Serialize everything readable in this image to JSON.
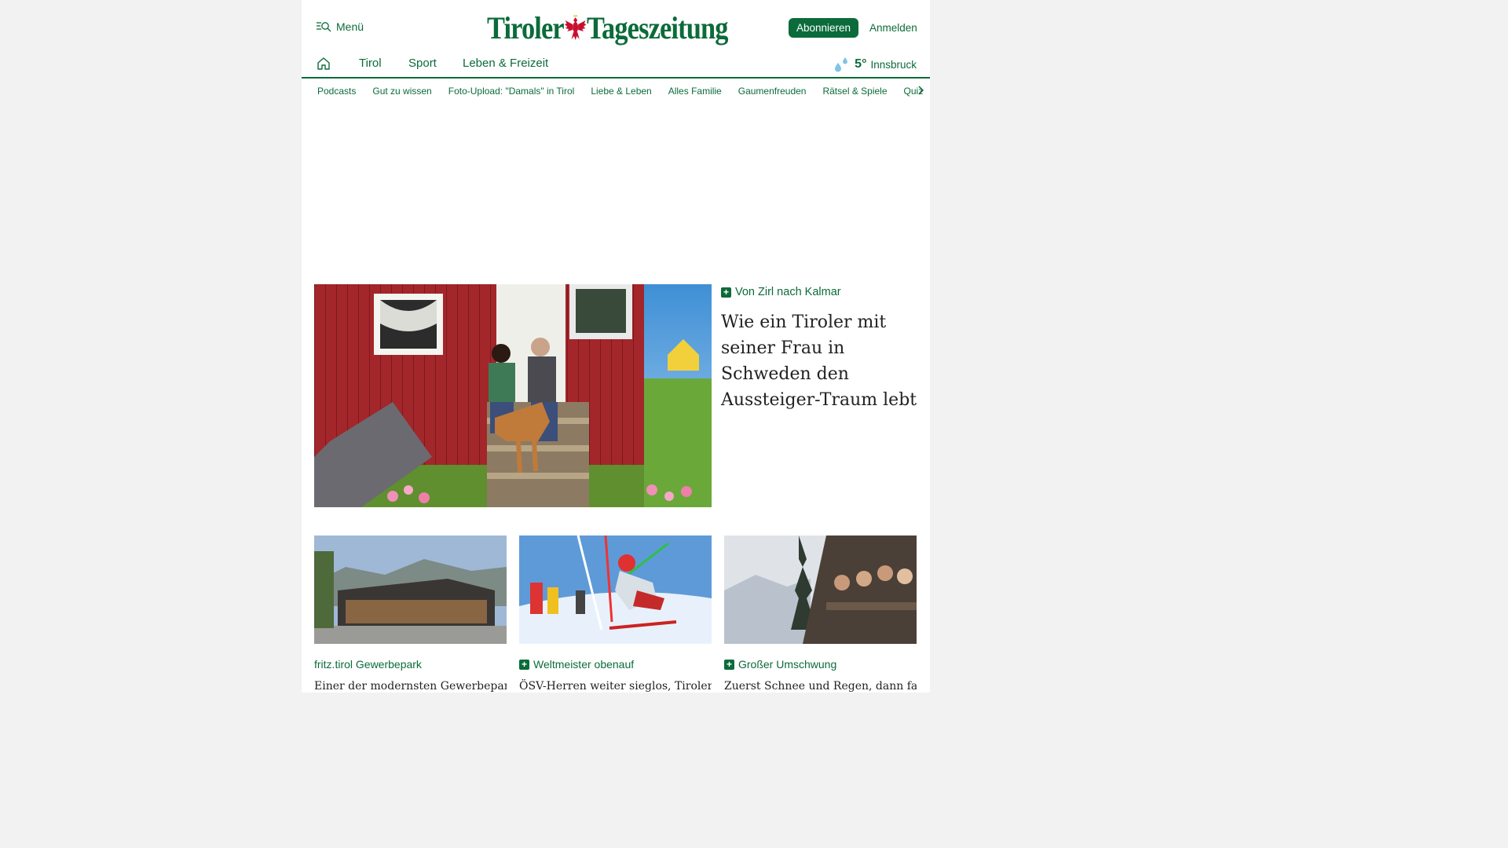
{
  "header": {
    "menu_label": "Menü",
    "logo_text_left": "Tiroler",
    "logo_text_right": "Tageszeitung",
    "subscribe_label": "Abonnieren",
    "login_label": "Anmelden"
  },
  "main_nav": {
    "items": [
      {
        "label": "Tirol"
      },
      {
        "label": "Sport"
      },
      {
        "label": "Leben & Freizeit"
      }
    ]
  },
  "weather": {
    "icon": "rain-drops-icon",
    "temperature": "5°",
    "city": "Innsbruck"
  },
  "sub_nav": {
    "items": [
      {
        "label": "Podcasts"
      },
      {
        "label": "Gut zu wissen"
      },
      {
        "label": "Foto-Upload: \"Damals\" in Tirol"
      },
      {
        "label": "Liebe & Leben"
      },
      {
        "label": "Alles Familie"
      },
      {
        "label": "Gaumenfreuden"
      },
      {
        "label": "Rätsel & Spiele"
      },
      {
        "label": "Quiz"
      }
    ]
  },
  "hero": {
    "kicker": "Von Zirl nach Kalmar",
    "title": "Wie ein Tiroler mit seiner Frau in Schweden den Aussteiger-Traum lebt",
    "premium": true
  },
  "cards": [
    {
      "kicker": "fritz.tirol Gewerbepark",
      "premium": false,
      "title": "Einer der modernsten Gewerbeparks"
    },
    {
      "kicker": "Weltmeister obenauf",
      "premium": true,
      "title": "ÖSV-Herren weiter sieglos, Tiroler"
    },
    {
      "kicker": "Großer Umschwung",
      "premium": true,
      "title": "Zuerst Schnee und Regen, dann fast"
    }
  ],
  "colors": {
    "brand_green": "#0b6b3a",
    "eagle_red": "#c8102e"
  }
}
